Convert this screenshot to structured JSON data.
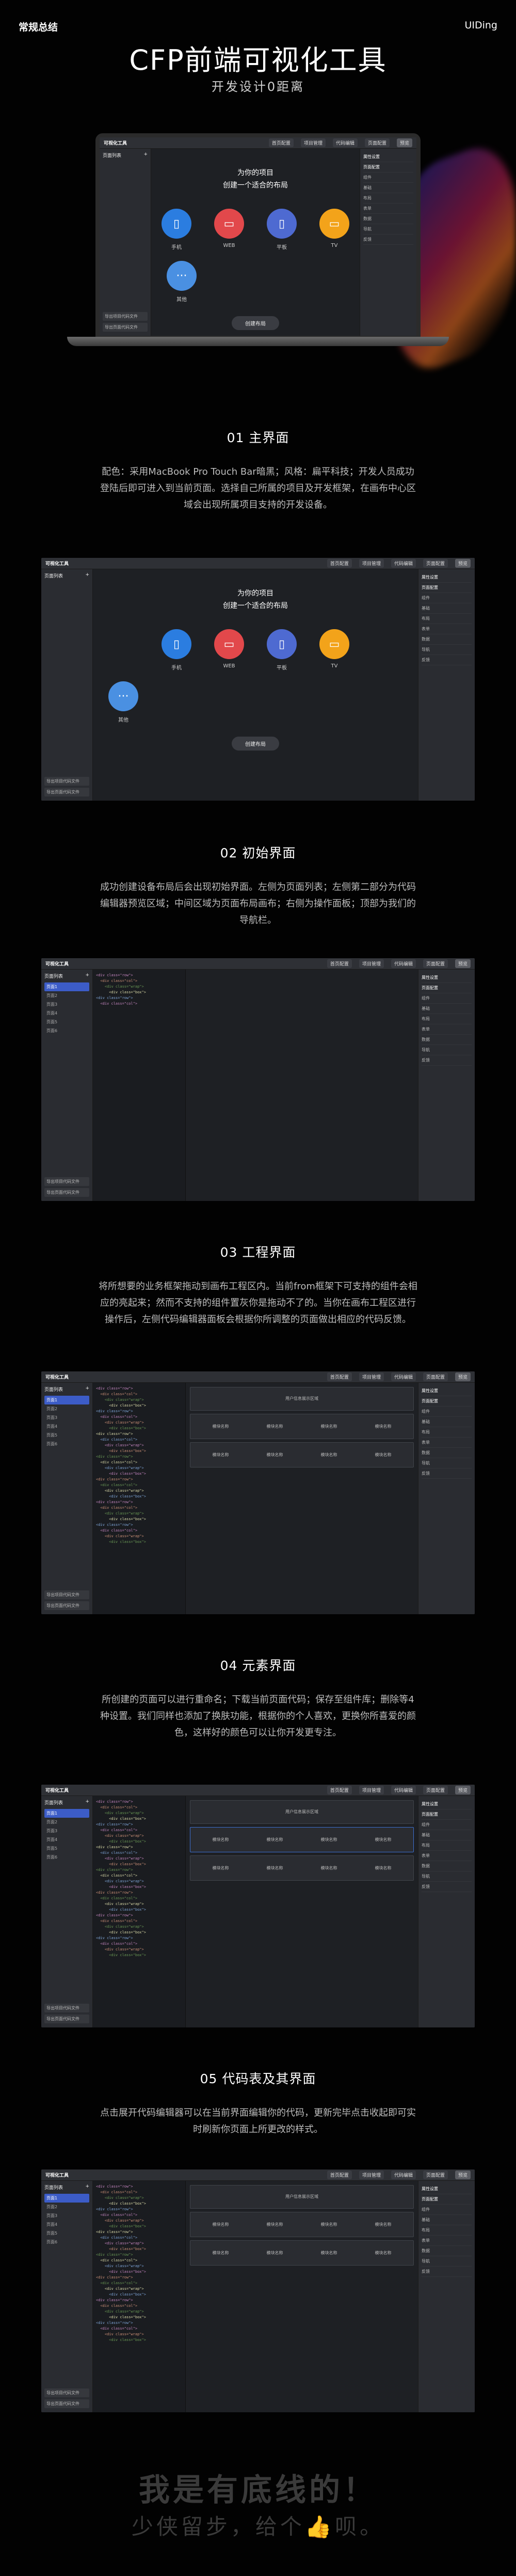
{
  "header": {
    "left": "常规总结",
    "right": "UIDing"
  },
  "hero": {
    "title": "CFP前端可视化工具",
    "subtitle": "开发设计0距离"
  },
  "app": {
    "brand": "可视化工具",
    "nav": [
      "首页配置",
      "项目管理",
      "代码编辑",
      "页面配置"
    ],
    "nav_active": "预览",
    "left_title": "页面列表",
    "left_items": [
      "页面1",
      "页面2",
      "页面3",
      "页面4",
      "页面5",
      "页面6"
    ],
    "left_footer": [
      "导出项目代码文件",
      "导出页面代码文件"
    ],
    "right_items": [
      "属性设置",
      "页面配置",
      "组件",
      "基础",
      "布局",
      "表单",
      "数据",
      "导航",
      "反馈"
    ],
    "home_line1": "为你的项目",
    "home_line2": "创建一个适合的布局",
    "devices": [
      {
        "label": "手机",
        "color": "#2b7de0",
        "icon": "▯"
      },
      {
        "label": "WEB",
        "color": "#e2484b",
        "icon": "▭"
      },
      {
        "label": "平板",
        "color": "#4e6ad1",
        "icon": "▯"
      },
      {
        "label": "TV",
        "color": "#f3a31a",
        "icon": "▭"
      }
    ],
    "device_extra": {
      "label": "其他",
      "color": "#4a90e2",
      "icon": "···"
    },
    "create_button": "创建布局",
    "canvas_banner": "用户信息展示区域",
    "canvas_cells": [
      "模块名称",
      "模块名称",
      "模块名称",
      "模块名称"
    ]
  },
  "sections": [
    {
      "title": "01 主界面",
      "desc": "配色：采用MacBook Pro Touch Bar暗黑；风格：扁平科技；开发人员成功登陆后即可进入到当前页面。选择自己所属的项目及开发框架，在画布中心区域会出现所属项目支持的开发设备。"
    },
    {
      "title": "02 初始界面",
      "desc": "成功创建设备布局后会出现初始界面。左侧为页面列表；左侧第二部分为代码编辑器预览区域；中间区域为页面布局画布；右侧为操作面板；顶部为我们的导航栏。"
    },
    {
      "title": "03 工程界面",
      "desc": "将所想要的业务框架拖动到画布工程区内。当前from框架下可支持的组件会相应的亮起来；然而不支持的组件置灰你是拖动不了的。当你在画布工程区进行操作后，左侧代码编辑器面板会根据你所调整的页面做出相应的代码反馈。"
    },
    {
      "title": "04 元素界面",
      "desc": "所创建的页面可以进行重命名；下载当前页面代码；保存至组件库；删除等4种设置。我们同样也添加了换肤功能，根据你的个人喜欢，更换你所喜爱的颜色，这样好的颜色可以让你开发更专注。"
    },
    {
      "title": "05 代码表及其界面",
      "desc": "点击展开代码编辑器可以在当前界面编辑你的代码，更新完毕点击收起即可实时刷新你页面上所更改的样式。"
    }
  ],
  "slogan": {
    "line1": "我是有底线的！",
    "line2": "少侠留步，给个👍呗。"
  }
}
